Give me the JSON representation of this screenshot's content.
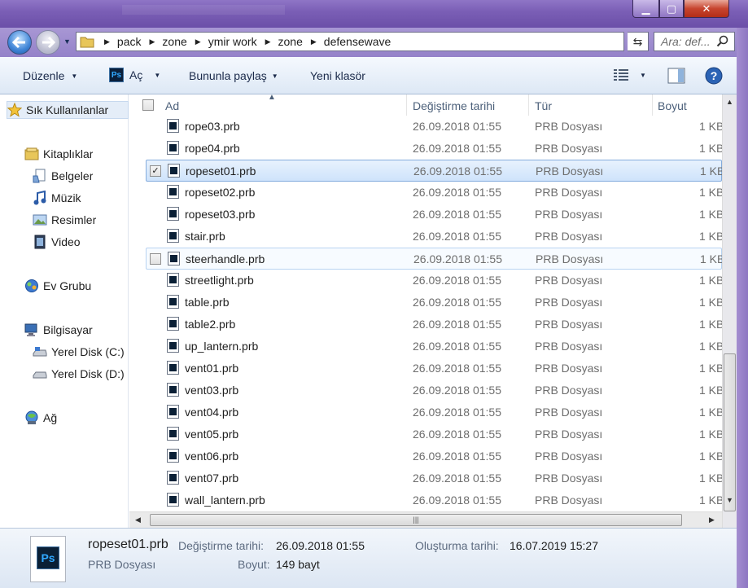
{
  "window": {
    "colors": {
      "titlebar": "#7b5fb6",
      "selection": "#cfe3fb",
      "close": "#c7452f"
    }
  },
  "address": {
    "breadcrumbs": [
      "pack",
      "zone",
      "ymir work",
      "zone",
      "defensewave"
    ],
    "search_placeholder": "Ara: def..."
  },
  "toolbar": {
    "organize": "Düzenle",
    "open": "Aç",
    "share": "Bununla paylaş",
    "new_folder": "Yeni klasör"
  },
  "nav": {
    "favorites": "Sık Kullanılanlar",
    "libraries": "Kitaplıklar",
    "documents": "Belgeler",
    "music": "Müzik",
    "pictures": "Resimler",
    "video": "Video",
    "homegroup": "Ev Grubu",
    "computer": "Bilgisayar",
    "disk_c": "Yerel Disk (C:)",
    "disk_d": "Yerel Disk (D:)",
    "network": "Ağ"
  },
  "columns": {
    "name": "Ad",
    "modified": "Değiştirme tarihi",
    "type": "Tür",
    "size": "Boyut"
  },
  "files": [
    {
      "name": "rope03.prb",
      "date": "26.09.2018 01:55",
      "type": "PRB Dosyası",
      "size": "1 KB"
    },
    {
      "name": "rope04.prb",
      "date": "26.09.2018 01:55",
      "type": "PRB Dosyası",
      "size": "1 KB"
    },
    {
      "name": "ropeset01.prb",
      "date": "26.09.2018 01:55",
      "type": "PRB Dosyası",
      "size": "1 KB",
      "selected": true,
      "checked": true
    },
    {
      "name": "ropeset02.prb",
      "date": "26.09.2018 01:55",
      "type": "PRB Dosyası",
      "size": "1 KB"
    },
    {
      "name": "ropeset03.prb",
      "date": "26.09.2018 01:55",
      "type": "PRB Dosyası",
      "size": "1 KB"
    },
    {
      "name": "stair.prb",
      "date": "26.09.2018 01:55",
      "type": "PRB Dosyası",
      "size": "1 KB"
    },
    {
      "name": "steerhandle.prb",
      "date": "26.09.2018 01:55",
      "type": "PRB Dosyası",
      "size": "1 KB",
      "hover": true
    },
    {
      "name": "streetlight.prb",
      "date": "26.09.2018 01:55",
      "type": "PRB Dosyası",
      "size": "1 KB"
    },
    {
      "name": "table.prb",
      "date": "26.09.2018 01:55",
      "type": "PRB Dosyası",
      "size": "1 KB"
    },
    {
      "name": "table2.prb",
      "date": "26.09.2018 01:55",
      "type": "PRB Dosyası",
      "size": "1 KB"
    },
    {
      "name": "up_lantern.prb",
      "date": "26.09.2018 01:55",
      "type": "PRB Dosyası",
      "size": "1 KB"
    },
    {
      "name": "vent01.prb",
      "date": "26.09.2018 01:55",
      "type": "PRB Dosyası",
      "size": "1 KB"
    },
    {
      "name": "vent03.prb",
      "date": "26.09.2018 01:55",
      "type": "PRB Dosyası",
      "size": "1 KB"
    },
    {
      "name": "vent04.prb",
      "date": "26.09.2018 01:55",
      "type": "PRB Dosyası",
      "size": "1 KB"
    },
    {
      "name": "vent05.prb",
      "date": "26.09.2018 01:55",
      "type": "PRB Dosyası",
      "size": "1 KB"
    },
    {
      "name": "vent06.prb",
      "date": "26.09.2018 01:55",
      "type": "PRB Dosyası",
      "size": "1 KB"
    },
    {
      "name": "vent07.prb",
      "date": "26.09.2018 01:55",
      "type": "PRB Dosyası",
      "size": "1 KB"
    },
    {
      "name": "wall_lantern.prb",
      "date": "26.09.2018 01:55",
      "type": "PRB Dosyası",
      "size": "1 KB"
    }
  ],
  "details": {
    "filename": "ropeset01.prb",
    "filetype": "PRB Dosyası",
    "modified_label": "Değiştirme tarihi:",
    "modified_value": "26.09.2018 01:55",
    "created_label": "Oluşturma tarihi:",
    "created_value": "16.07.2019 15:27",
    "size_label": "Boyut:",
    "size_value": "149 bayt"
  }
}
